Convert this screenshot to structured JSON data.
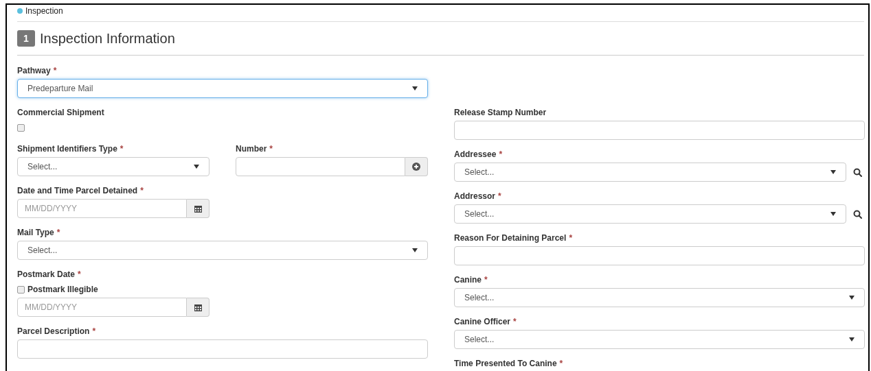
{
  "breadcrumb": {
    "label": "Inspection",
    "color": "#5bc0de"
  },
  "section": {
    "number": "1",
    "title": "Inspection Information"
  },
  "pathway": {
    "label": "Pathway",
    "required_mark": "*",
    "kind": "select",
    "value": "Predeparture Mail",
    "focused": true
  },
  "left_fields": [
    {
      "label": "Commercial Shipment",
      "kind": "checkbox",
      "checked": false
    },
    {
      "kind": "pair",
      "fields": [
        {
          "label": "Shipment Identifiers Type",
          "required_mark": "*",
          "kind": "select",
          "placeholder": "Select..."
        },
        {
          "label": "Number",
          "required_mark": "*",
          "kind": "text_add"
        }
      ]
    },
    {
      "label": "Date and Time Parcel Detained",
      "required_mark": "*",
      "kind": "date",
      "placeholder": "MM/DD/YYYY"
    },
    {
      "label": "Mail Type",
      "required_mark": "*",
      "kind": "select",
      "placeholder": "Select..."
    },
    {
      "label": "Postmark Date",
      "required_mark": "*",
      "kind": "date",
      "placeholder": "MM/DD/YYYY",
      "checkbox": {
        "label": "Postmark Illegible",
        "checked": false
      }
    },
    {
      "label": "Parcel Description",
      "required_mark": "*",
      "kind": "text"
    }
  ],
  "right_fields": [
    {
      "label": "Release Stamp Number",
      "kind": "text"
    },
    {
      "label": "Addressee",
      "required_mark": "*",
      "kind": "select_search",
      "placeholder": "Select..."
    },
    {
      "label": "Addressor",
      "required_mark": "*",
      "kind": "select_search",
      "placeholder": "Select..."
    },
    {
      "label": "Reason For Detaining Parcel",
      "required_mark": "*",
      "kind": "text"
    },
    {
      "label": "Canine",
      "required_mark": "*",
      "kind": "select",
      "placeholder": "Select..."
    },
    {
      "label": "Canine Officer",
      "required_mark": "*",
      "kind": "select",
      "placeholder": "Select..."
    },
    {
      "label": "Time Presented To Canine",
      "required_mark": "*",
      "kind": "label_only"
    }
  ]
}
